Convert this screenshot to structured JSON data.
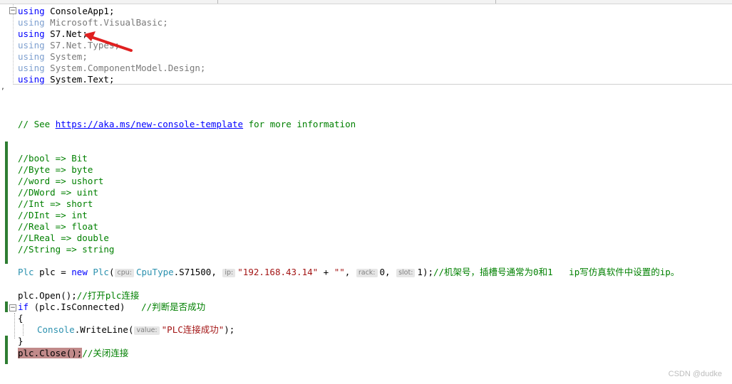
{
  "usings": [
    {
      "kw": "using",
      "ns": "ConsoleApp1;",
      "dim": false
    },
    {
      "kw": "using",
      "ns": "Microsoft.VisualBasic;",
      "dim": true
    },
    {
      "kw": "using",
      "ns": "S7.Net;",
      "dim": false
    },
    {
      "kw": "using",
      "ns": "S7.Net.Types;",
      "dim": true
    },
    {
      "kw": "using",
      "ns": "System;",
      "dim": true
    },
    {
      "kw": "using",
      "ns": "System.ComponentModel.Design;",
      "dim": true
    },
    {
      "kw": "using",
      "ns": "System.Text;",
      "dim": false
    }
  ],
  "see_comment": {
    "prefix": "// See ",
    "link": "https://aka.ms/new-console-template",
    "suffix": " for more information"
  },
  "type_comments": [
    "//bool => Bit",
    "//Byte => byte",
    "//word => ushort",
    "//DWord => uint",
    "//Int => short",
    "//DInt => int",
    "//Real => float",
    "//LReal => double",
    "//String => string"
  ],
  "plc_line": {
    "type": "Plc",
    "var": " plc = ",
    "new": "new",
    "ctor": "Plc",
    "hint_cpu": "cpu:",
    "cpu_type": "CpuType",
    "cpu_val": ".S71500, ",
    "hint_ip": "ip:",
    "ip_str": "\"192.168.43.14\"",
    "plus": " + ",
    "empty_str": "\"\"",
    "comma": ", ",
    "hint_rack": "rack:",
    "rack_val": "0, ",
    "hint_slot": "slot:",
    "slot_val": "1);",
    "comment": "//机架号，插槽号通常为0和1   ip写仿真软件中设置的ip。"
  },
  "open_line": {
    "code": "plc.Open();",
    "comment": "//打开plc连接"
  },
  "if_line": {
    "kw": "if",
    "code": " (plc.IsConnected)   ",
    "comment": "//判断是否成功"
  },
  "brace_open": "{",
  "console_line": {
    "cls": "Console",
    "method": ".WriteLine(",
    "hint": "value:",
    "str": "\"PLC连接成功\"",
    "end": ");"
  },
  "brace_close": "}",
  "close_line": {
    "code": "plc.Close();",
    "comment": "//关闭连接"
  },
  "watermark": "CSDN @dudke",
  "colors": {
    "keyword": "#0000ff",
    "comment": "#008000",
    "type": "#2b91af",
    "string": "#a31515",
    "change_bar": "#2e7d32",
    "annotation_arrow": "#e02020"
  }
}
